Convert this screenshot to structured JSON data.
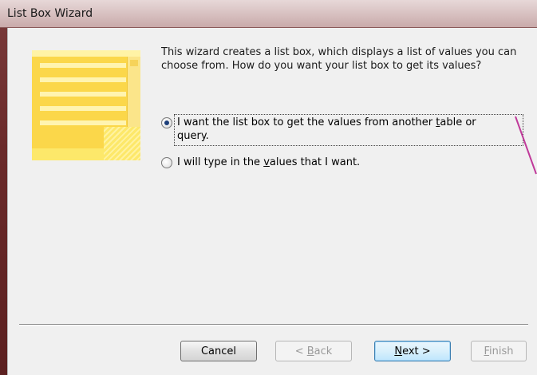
{
  "window": {
    "title": "List Box Wizard"
  },
  "description": "This wizard creates a list box, which displays a list of values you can choose from.  How do you want your list box to get its values?",
  "options": [
    {
      "label_a": "I want the list box to get the values from another ",
      "label_mn": "t",
      "label_b": "able or",
      "label_c": "query.",
      "selected": true
    },
    {
      "label_a": "I will type in the ",
      "label_mn": "v",
      "label_b": "alues that I want.",
      "selected": false
    }
  ],
  "buttons": {
    "cancel": "Cancel",
    "back_pre": "< ",
    "back_mn": "B",
    "back_post": "ack",
    "next_pre": "",
    "next_mn": "N",
    "next_post": "ext >",
    "finish_mn": "F",
    "finish_post": "inish"
  }
}
